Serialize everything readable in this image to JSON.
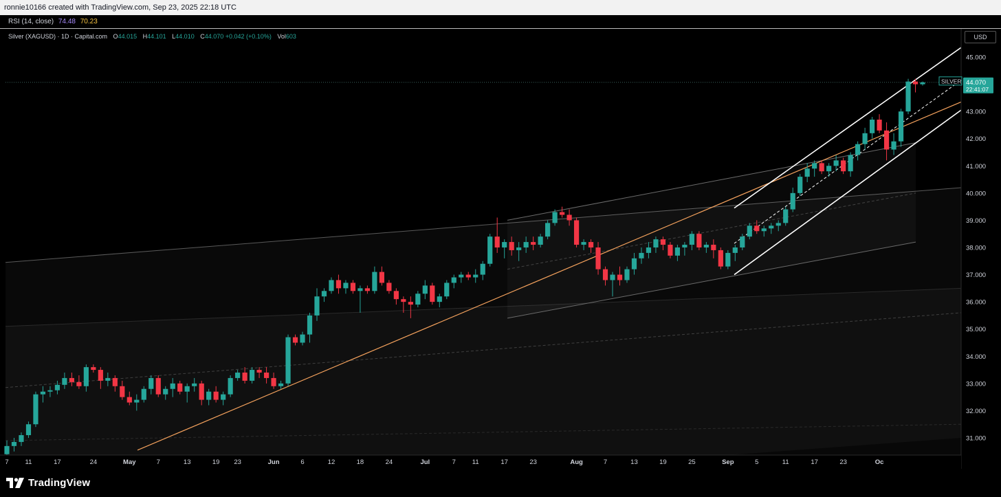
{
  "header": {
    "credit": "ronnie10166 created with TradingView.com, Sep 23, 2025 22:18 UTC"
  },
  "rsi": {
    "label": "RSI (14, close)",
    "value1": "74.48",
    "value2": "70.23"
  },
  "legend": {
    "symbol": "Silver (XAGUSD) · 1D · Capital.com",
    "o_key": "O",
    "o": "44.015",
    "h_key": "H",
    "h": "44.101",
    "l_key": "L",
    "l": "44.010",
    "c_key": "C",
    "c": "44.070",
    "change": "+0.042 (+0.10%)",
    "vol_key": "Vol",
    "vol": "603"
  },
  "price_axis": {
    "currency": "USD",
    "last_symbol": "SILVER",
    "last_price": "44.070",
    "countdown": "22:41:07"
  },
  "brand": {
    "name": "TradingView"
  },
  "colors": {
    "up": "#26a69a",
    "down": "#f23645",
    "trend": "#f5a25d",
    "channel": "#ffffff"
  },
  "chart_data": {
    "type": "candlestick",
    "ylim": [
      30.5,
      45.5
    ],
    "y_ticks": [
      "45.000",
      "44.000",
      "43.000",
      "42.000",
      "41.000",
      "40.000",
      "39.000",
      "38.000",
      "37.000",
      "36.000",
      "35.000",
      "34.000",
      "33.000",
      "32.000",
      "31.000"
    ],
    "y_values": [
      45,
      44,
      43,
      42,
      41,
      40,
      39,
      38,
      37,
      36,
      35,
      34,
      33,
      32,
      31
    ],
    "x_ticks": [
      "7",
      "11",
      "17",
      "24",
      "May",
      "7",
      "13",
      "19",
      "23",
      "Jun",
      "6",
      "12",
      "18",
      "24",
      "Jul",
      "7",
      "11",
      "17",
      "23",
      "Aug",
      "7",
      "13",
      "19",
      "25",
      "Sep",
      "5",
      "11",
      "17",
      "23",
      "Oc"
    ],
    "x_tick_index": [
      0,
      3,
      7,
      12,
      17,
      21,
      25,
      29,
      32,
      37,
      41,
      45,
      49,
      53,
      58,
      62,
      65,
      69,
      73,
      79,
      83,
      87,
      91,
      95,
      100,
      104,
      108,
      112,
      116,
      121
    ],
    "ohlc": [
      [
        30.4,
        30.9,
        30.2,
        30.7
      ],
      [
        30.7,
        31.0,
        30.5,
        30.85
      ],
      [
        30.85,
        31.2,
        30.7,
        31.1
      ],
      [
        31.1,
        31.6,
        31.0,
        31.5
      ],
      [
        31.5,
        32.7,
        31.4,
        32.6
      ],
      [
        32.6,
        32.9,
        32.3,
        32.7
      ],
      [
        32.7,
        32.9,
        32.5,
        32.75
      ],
      [
        32.75,
        33.1,
        32.6,
        32.95
      ],
      [
        32.95,
        33.4,
        32.8,
        33.2
      ],
      [
        33.2,
        33.4,
        32.9,
        33.05
      ],
      [
        33.05,
        33.3,
        32.8,
        32.9
      ],
      [
        32.9,
        33.7,
        32.7,
        33.6
      ],
      [
        33.6,
        33.7,
        33.4,
        33.5
      ],
      [
        33.5,
        33.6,
        32.8,
        33.1
      ],
      [
        33.1,
        33.4,
        32.9,
        33.2
      ],
      [
        33.2,
        33.3,
        32.7,
        32.9
      ],
      [
        32.9,
        33.1,
        32.4,
        32.5
      ],
      [
        32.5,
        32.7,
        32.2,
        32.3
      ],
      [
        32.3,
        32.6,
        32.0,
        32.4
      ],
      [
        32.4,
        32.9,
        32.3,
        32.8
      ],
      [
        32.8,
        33.3,
        32.6,
        33.2
      ],
      [
        33.2,
        33.3,
        32.5,
        32.6
      ],
      [
        32.6,
        32.9,
        32.4,
        32.8
      ],
      [
        32.8,
        33.2,
        32.5,
        33.0
      ],
      [
        33.0,
        33.1,
        32.6,
        32.7
      ],
      [
        32.7,
        33.0,
        32.3,
        32.9
      ],
      [
        32.9,
        33.2,
        32.7,
        33.0
      ],
      [
        33.0,
        33.1,
        32.2,
        32.4
      ],
      [
        32.4,
        32.8,
        32.2,
        32.7
      ],
      [
        32.7,
        32.9,
        32.3,
        32.4
      ],
      [
        32.4,
        32.7,
        32.2,
        32.6
      ],
      [
        32.6,
        33.3,
        32.5,
        33.2
      ],
      [
        33.2,
        33.5,
        33.1,
        33.4
      ],
      [
        33.4,
        33.6,
        33.0,
        33.1
      ],
      [
        33.1,
        33.6,
        33.0,
        33.5
      ],
      [
        33.5,
        33.6,
        33.2,
        33.4
      ],
      [
        33.4,
        33.6,
        33.0,
        33.2
      ],
      [
        33.2,
        33.4,
        32.8,
        32.9
      ],
      [
        32.9,
        33.1,
        32.8,
        33.0
      ],
      [
        33.0,
        34.8,
        32.9,
        34.7
      ],
      [
        34.7,
        34.8,
        34.4,
        34.5
      ],
      [
        34.5,
        34.9,
        34.4,
        34.8
      ],
      [
        34.8,
        35.6,
        34.5,
        35.5
      ],
      [
        35.5,
        36.5,
        35.3,
        36.2
      ],
      [
        36.2,
        36.5,
        36.0,
        36.4
      ],
      [
        36.4,
        36.9,
        36.3,
        36.8
      ],
      [
        36.8,
        37.0,
        36.3,
        36.5
      ],
      [
        36.5,
        36.8,
        36.3,
        36.7
      ],
      [
        36.7,
        36.8,
        36.3,
        36.4
      ],
      [
        36.4,
        36.6,
        35.6,
        36.5
      ],
      [
        36.5,
        36.6,
        36.3,
        36.4
      ],
      [
        36.4,
        37.3,
        36.3,
        37.1
      ],
      [
        37.1,
        37.3,
        36.6,
        36.7
      ],
      [
        36.7,
        36.8,
        36.3,
        36.4
      ],
      [
        36.4,
        36.5,
        35.9,
        36.1
      ],
      [
        36.1,
        36.2,
        35.6,
        36.0
      ],
      [
        36.0,
        36.2,
        35.4,
        35.9
      ],
      [
        35.9,
        36.4,
        35.8,
        36.3
      ],
      [
        36.3,
        36.8,
        36.1,
        36.6
      ],
      [
        36.6,
        36.7,
        35.9,
        36.0
      ],
      [
        36.0,
        36.3,
        35.8,
        36.2
      ],
      [
        36.2,
        36.8,
        36.1,
        36.7
      ],
      [
        36.7,
        37.0,
        36.5,
        36.9
      ],
      [
        36.9,
        37.1,
        36.7,
        37.0
      ],
      [
        37.0,
        37.1,
        36.8,
        36.9
      ],
      [
        36.9,
        37.2,
        36.7,
        37.0
      ],
      [
        37.0,
        37.5,
        36.8,
        37.4
      ],
      [
        37.4,
        38.5,
        37.3,
        38.4
      ],
      [
        38.4,
        39.1,
        37.8,
        38.0
      ],
      [
        38.0,
        38.3,
        37.6,
        38.2
      ],
      [
        38.2,
        38.4,
        37.7,
        37.9
      ],
      [
        37.9,
        38.2,
        37.5,
        38.0
      ],
      [
        38.0,
        38.4,
        37.8,
        38.2
      ],
      [
        38.2,
        38.4,
        37.9,
        38.1
      ],
      [
        38.1,
        38.5,
        38.0,
        38.4
      ],
      [
        38.4,
        39.0,
        38.3,
        38.9
      ],
      [
        38.9,
        39.4,
        38.8,
        39.3
      ],
      [
        39.3,
        39.5,
        39.1,
        39.2
      ],
      [
        39.2,
        39.4,
        38.8,
        39.0
      ],
      [
        39.0,
        39.1,
        38.0,
        38.1
      ],
      [
        38.1,
        38.3,
        37.9,
        38.2
      ],
      [
        38.2,
        38.3,
        37.8,
        38.0
      ],
      [
        38.0,
        38.2,
        37.0,
        37.2
      ],
      [
        37.2,
        37.3,
        36.6,
        36.8
      ],
      [
        36.8,
        37.1,
        36.2,
        37.0
      ],
      [
        37.0,
        37.3,
        36.6,
        36.8
      ],
      [
        36.8,
        37.3,
        36.7,
        37.2
      ],
      [
        37.2,
        37.8,
        37.0,
        37.6
      ],
      [
        37.6,
        38.0,
        37.4,
        37.8
      ],
      [
        37.8,
        38.2,
        37.6,
        38.0
      ],
      [
        38.0,
        38.4,
        37.8,
        38.3
      ],
      [
        38.3,
        38.4,
        37.9,
        38.1
      ],
      [
        38.1,
        38.2,
        37.6,
        37.7
      ],
      [
        37.7,
        38.1,
        37.5,
        38.0
      ],
      [
        38.0,
        38.2,
        37.7,
        38.1
      ],
      [
        38.1,
        38.6,
        37.9,
        38.5
      ],
      [
        38.5,
        38.6,
        37.9,
        38.0
      ],
      [
        38.0,
        38.2,
        37.8,
        38.1
      ],
      [
        38.1,
        38.3,
        37.6,
        37.9
      ],
      [
        37.9,
        38.0,
        37.2,
        37.3
      ],
      [
        37.3,
        37.9,
        37.2,
        37.8
      ],
      [
        37.8,
        38.1,
        37.5,
        38.0
      ],
      [
        38.0,
        38.5,
        37.9,
        38.4
      ],
      [
        38.4,
        38.9,
        38.3,
        38.8
      ],
      [
        38.8,
        39.0,
        38.5,
        38.6
      ],
      [
        38.6,
        38.8,
        38.4,
        38.7
      ],
      [
        38.7,
        38.9,
        38.5,
        38.8
      ],
      [
        38.8,
        39.0,
        38.6,
        38.9
      ],
      [
        38.9,
        39.5,
        38.8,
        39.4
      ],
      [
        39.4,
        40.2,
        39.3,
        40.0
      ],
      [
        40.0,
        40.7,
        39.9,
        40.6
      ],
      [
        40.6,
        41.1,
        40.4,
        40.9
      ],
      [
        40.9,
        41.2,
        40.6,
        41.1
      ],
      [
        41.1,
        41.2,
        40.7,
        40.8
      ],
      [
        40.8,
        41.1,
        40.6,
        41.0
      ],
      [
        41.0,
        41.4,
        40.8,
        41.2
      ],
      [
        41.2,
        41.3,
        40.7,
        40.8
      ],
      [
        40.8,
        41.5,
        40.6,
        41.4
      ],
      [
        41.4,
        41.9,
        41.2,
        41.8
      ],
      [
        41.8,
        42.4,
        41.6,
        42.2
      ],
      [
        42.2,
        42.8,
        42.0,
        42.7
      ],
      [
        42.7,
        42.9,
        42.2,
        42.3
      ],
      [
        42.3,
        42.6,
        41.2,
        41.6
      ],
      [
        41.6,
        42.2,
        41.4,
        41.9
      ],
      [
        41.9,
        43.1,
        41.7,
        43.0
      ],
      [
        43.0,
        44.2,
        42.9,
        44.1
      ],
      [
        44.1,
        44.2,
        43.7,
        44.0
      ],
      [
        44.0,
        44.1,
        43.95,
        44.07
      ]
    ]
  }
}
